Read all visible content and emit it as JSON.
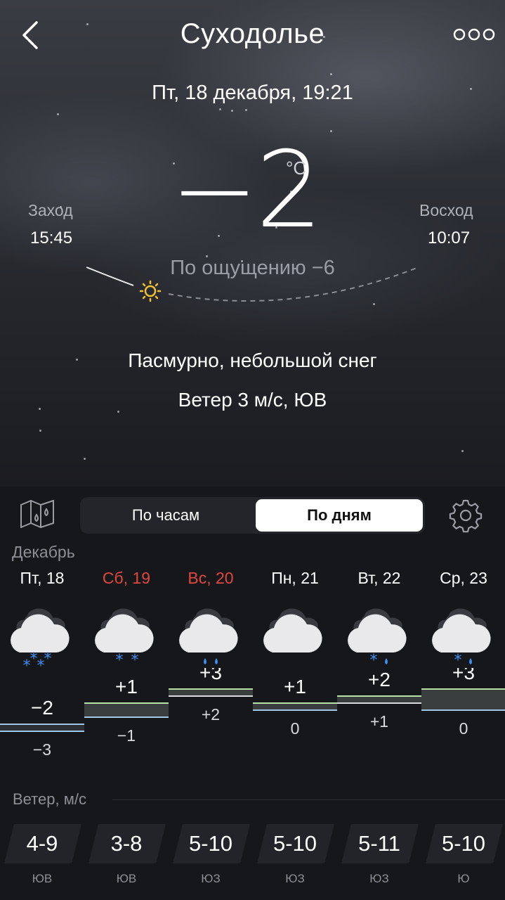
{
  "header": {
    "city": "Суходолье",
    "datetime": "Пт, 18 декабря, 19:21",
    "back_icon": "chevron-left-icon",
    "more_icon": "more-dots-icon"
  },
  "current": {
    "temperature": "−2",
    "unit": "°C",
    "feels_like": "По ощущению −6",
    "sunset_label": "Заход",
    "sunset_time": "15:45",
    "sunrise_label": "Восход",
    "sunrise_time": "10:07",
    "condition": "Пасмурно, небольшой снег",
    "wind": "Ветер 3 м/с, ЮВ"
  },
  "controls": {
    "map_icon": "map-rain-icon",
    "tab_hours": "По часам",
    "tab_days": "По дням",
    "selected_tab": "По дням",
    "settings_icon": "gear-icon"
  },
  "forecast": {
    "month": "Декабрь",
    "days": [
      {
        "label": "Пт, 18",
        "weekend": false,
        "icon": "cloud-snow-icon",
        "precip": "heavy-snow",
        "high": "−2",
        "low": "−3",
        "high_val": -2,
        "low_val": -3,
        "wind": "4-9",
        "wind_dir": "ЮВ"
      },
      {
        "label": "Сб, 19",
        "weekend": true,
        "icon": "cloud-snow-icon",
        "precip": "light-snow",
        "high": "+1",
        "low": "−1",
        "high_val": 1,
        "low_val": -1,
        "wind": "3-8",
        "wind_dir": "ЮВ"
      },
      {
        "label": "Вс, 20",
        "weekend": true,
        "icon": "cloud-rain-icon",
        "precip": "rain",
        "high": "+3",
        "low": "+2",
        "high_val": 3,
        "low_val": 2,
        "wind": "5-10",
        "wind_dir": "ЮЗ"
      },
      {
        "label": "Пн, 21",
        "weekend": false,
        "icon": "cloud-icon",
        "precip": "none",
        "high": "+1",
        "low": "0",
        "high_val": 1,
        "low_val": 0,
        "wind": "5-10",
        "wind_dir": "ЮЗ"
      },
      {
        "label": "Вт, 22",
        "weekend": false,
        "icon": "cloud-sleet-icon",
        "precip": "sleet",
        "high": "+2",
        "low": "+1",
        "high_val": 2,
        "low_val": 1,
        "wind": "5-11",
        "wind_dir": "ЮЗ"
      },
      {
        "label": "Ср, 23",
        "weekend": false,
        "icon": "cloud-sleet-icon",
        "precip": "sleet",
        "high": "+3",
        "low": "0",
        "high_val": 3,
        "low_val": 0,
        "wind": "5-10",
        "wind_dir": "Ю"
      }
    ]
  },
  "wind_section": {
    "title": "Ветер, м/с"
  },
  "colors": {
    "weekend": "#e0473e",
    "precip_blue": "#3d8ef0",
    "sun_yellow": "#f2c12e",
    "cold_line": "#9fc8e8",
    "warm_line": "#b6e0a6"
  }
}
